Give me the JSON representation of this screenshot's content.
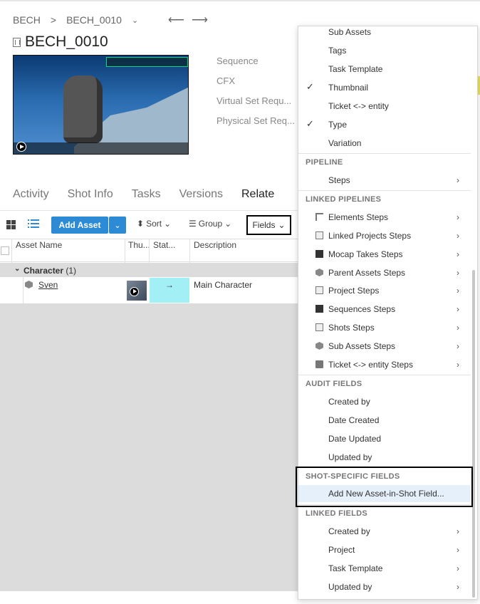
{
  "breadcrumb": {
    "project": "BECH",
    "separator": ">",
    "shot": "BECH_0010"
  },
  "nav": {
    "back": "⟵",
    "forward": "⟶"
  },
  "page_title": "BECH_0010",
  "field_labels": [
    "Sequence",
    "CFX",
    "Virtual Set Requ...",
    "Physical Set Req..."
  ],
  "tabs": [
    {
      "label": "Activity"
    },
    {
      "label": "Shot Info"
    },
    {
      "label": "Tasks"
    },
    {
      "label": "Versions"
    },
    {
      "label": "Relate"
    }
  ],
  "toolbar": {
    "add_asset": "Add Asset",
    "sort": "Sort",
    "group": "Group",
    "fields": "Fields"
  },
  "columns": [
    "Asset Name",
    "Thu...",
    "Stat...",
    "Description"
  ],
  "group": {
    "name": "Character",
    "count": "(1)"
  },
  "asset": {
    "name": "Sven",
    "status_icon": "→",
    "description": "Main Character"
  },
  "menu": {
    "top_items": [
      {
        "label": "Sub Assets",
        "checked": false
      },
      {
        "label": "Tags",
        "checked": false
      },
      {
        "label": "Task Template",
        "checked": false
      },
      {
        "label": "Thumbnail",
        "checked": true
      },
      {
        "label": "Ticket <-> entity",
        "checked": false
      },
      {
        "label": "Type",
        "checked": true
      },
      {
        "label": "Variation",
        "checked": false
      }
    ],
    "check_mark": "✓",
    "pipeline_header": "PIPELINE",
    "pipeline_items": [
      {
        "label": "Steps"
      }
    ],
    "linked_pipelines_header": "LINKED PIPELINES",
    "linked_pipelines": [
      {
        "label": "Elements Steps",
        "icon": "steps-icon"
      },
      {
        "label": "Linked Projects Steps",
        "icon": "doc-icon"
      },
      {
        "label": "Mocap Takes Steps",
        "icon": "film-icon"
      },
      {
        "label": "Parent Assets Steps",
        "icon": "cube-icon"
      },
      {
        "label": "Project Steps",
        "icon": "doc-icon"
      },
      {
        "label": "Sequences Steps",
        "icon": "film-icon"
      },
      {
        "label": "Shots Steps",
        "icon": "doc-icon"
      },
      {
        "label": "Sub Assets Steps",
        "icon": "cube-icon"
      },
      {
        "label": "Ticket <-> entity Steps",
        "icon": "ticket-icon"
      }
    ],
    "audit_header": "AUDIT FIELDS",
    "audit_items": [
      {
        "label": "Created by"
      },
      {
        "label": "Date Created"
      },
      {
        "label": "Date Updated"
      },
      {
        "label": "Updated by"
      }
    ],
    "shot_specific_header": "SHOT-SPECIFIC FIELDS",
    "shot_specific_items": [
      {
        "label": "Add New Asset-in-Shot Field..."
      }
    ],
    "linked_fields_header": "LINKED FIELDS",
    "linked_fields": [
      {
        "label": "Created by"
      },
      {
        "label": "Project"
      },
      {
        "label": "Task Template"
      },
      {
        "label": "Updated by"
      }
    ],
    "submenu_arrow": "›"
  },
  "colors": {
    "accent": "#2d8ad4",
    "status": "#a2eff6",
    "highlight": "#e5f0fb"
  }
}
